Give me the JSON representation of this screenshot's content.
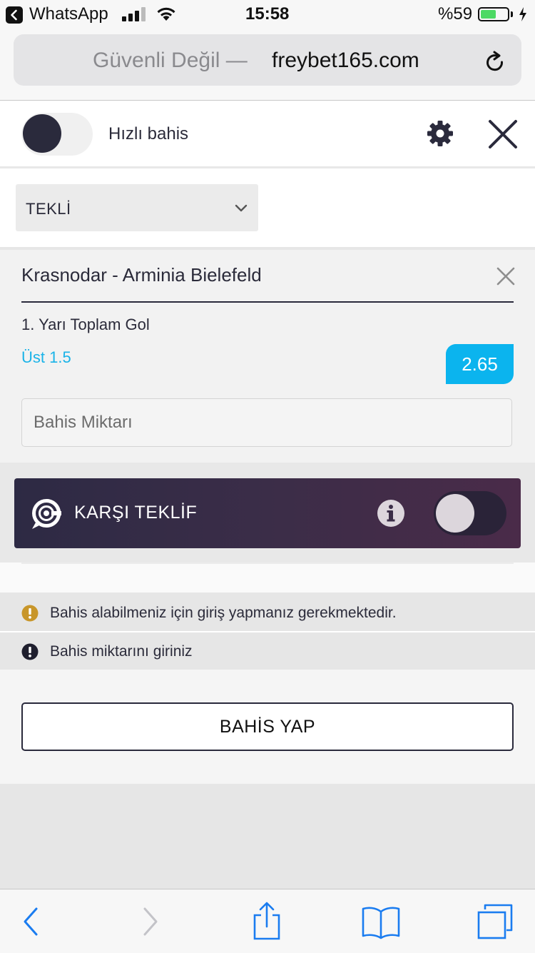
{
  "status_bar": {
    "back_app": "WhatsApp",
    "time": "15:58",
    "battery": "%59",
    "battery_level": 0.59
  },
  "url_bar": {
    "security": "Güvenli Değil —",
    "domain": "freybet165.com"
  },
  "header": {
    "quick_bet_label": "Hızlı bahis",
    "quick_bet_on": false
  },
  "bet_type": {
    "selected": "TEKLİ"
  },
  "bet": {
    "match": "Krasnodar - Arminia Bielefeld",
    "market": "1. Yarı Toplam Gol",
    "selection": "Üst 1.5",
    "odds": "2.65",
    "stake_placeholder": "Bahis Miktarı"
  },
  "counter_offer": {
    "label": "KARŞI TEKLİF",
    "enabled": false
  },
  "messages": [
    {
      "type": "warning",
      "text": "Bahis alabilmeniz için giriş yapmanız gerekmektedir."
    },
    {
      "type": "error",
      "text": "Bahis miktarını giriniz"
    }
  ],
  "place_bet_label": "BAHİS YAP",
  "colors": {
    "accent": "#0bb4ee",
    "dark": "#2a2a3c",
    "warning": "#c8962a",
    "ios_blue": "#1a7cf0"
  },
  "toolbar": {
    "icons": [
      "back-icon",
      "forward-icon",
      "share-icon",
      "bookmarks-icon",
      "tabs-icon"
    ]
  }
}
